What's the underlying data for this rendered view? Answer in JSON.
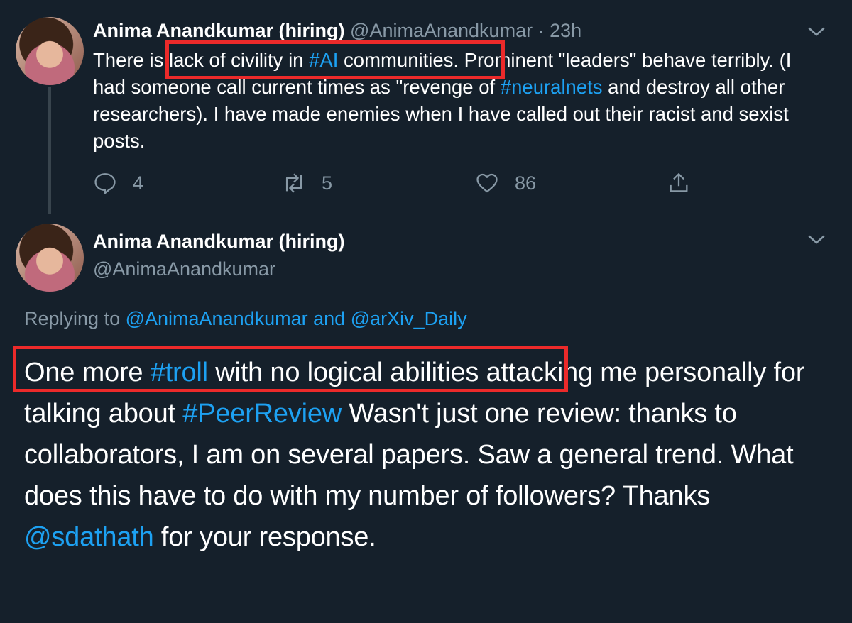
{
  "tweet1": {
    "name": "Anima Anandkumar (hiring)",
    "handle": "@AnimaAnandkumar",
    "separator": "·",
    "time": "23h",
    "body": [
      {
        "t": "There is ",
        "link": false
      },
      {
        "t": "lack of civility in ",
        "link": false
      },
      {
        "t": "#AI",
        "link": true
      },
      {
        "t": " communities",
        "link": false
      },
      {
        "t": ". Prominent \"leaders\" behave terribly. (I had someone call current times as \"revenge of ",
        "link": false
      },
      {
        "t": "#neuralnets",
        "link": true
      },
      {
        "t": " and destroy all other researchers). I have made enemies when I have called out their racist and sexist posts.",
        "link": false
      }
    ],
    "reply_count": "4",
    "retweet_count": "5",
    "like_count": "86"
  },
  "tweet2": {
    "name": "Anima Anandkumar (hiring)",
    "handle": "@AnimaAnandkumar",
    "replying_prefix": "Replying to ",
    "replying_user1": "@AnimaAnandkumar",
    "replying_and": " and ",
    "replying_user2": "@arXiv_Daily",
    "body": [
      {
        "t": "One more ",
        "link": false
      },
      {
        "t": "#troll",
        "link": true
      },
      {
        "t": " with no logical abilities attacking me personally for talking about ",
        "link": false
      },
      {
        "t": "#PeerReview",
        "link": true
      },
      {
        "t": " Wasn't just one review: thanks to collaborators, I am on several papers. Saw a general trend. What does this have to do with my number of followers? Thanks ",
        "link": false
      },
      {
        "t": "@sdathath",
        "link": true
      },
      {
        "t": " for your response.",
        "link": false
      }
    ]
  },
  "colors": {
    "background": "#15202b",
    "link": "#1da1f2",
    "muted": "#8899a6",
    "highlight": "#ec2a2a"
  },
  "icons": [
    "reply-icon",
    "retweet-icon",
    "like-icon",
    "share-icon",
    "chevron-down-icon"
  ]
}
